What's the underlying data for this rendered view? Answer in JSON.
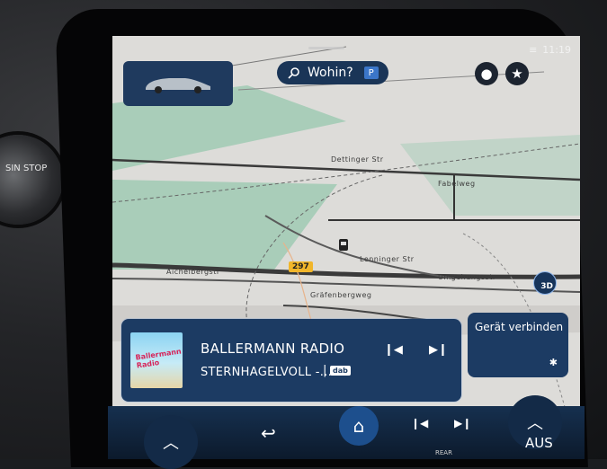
{
  "knob": {
    "label": "SIN\nSTOP"
  },
  "status": {
    "time": "11:19"
  },
  "search": {
    "label": "Wohin?",
    "badge": "P"
  },
  "map": {
    "roads": [
      "Dettinger Str",
      "Fabelweg",
      "Lenninger Str",
      "Aichelbergstr",
      "Umgehungsstr",
      "Gräfenbergweg"
    ],
    "route_number": "297",
    "view_mode": "3D"
  },
  "media": {
    "station": "BALLERMANN RADIO",
    "track": "STERNHAGELVOLL -...",
    "source": "dab",
    "cover_text": "Ballermann Radio"
  },
  "connect": {
    "label": "Gerät verbinden"
  },
  "controls": {
    "off_label": "AUS",
    "rear_label": "REAR"
  },
  "colors": {
    "panel": "#1c3b63",
    "accent": "#1d4f8d",
    "route_badge": "#f1b62b"
  }
}
